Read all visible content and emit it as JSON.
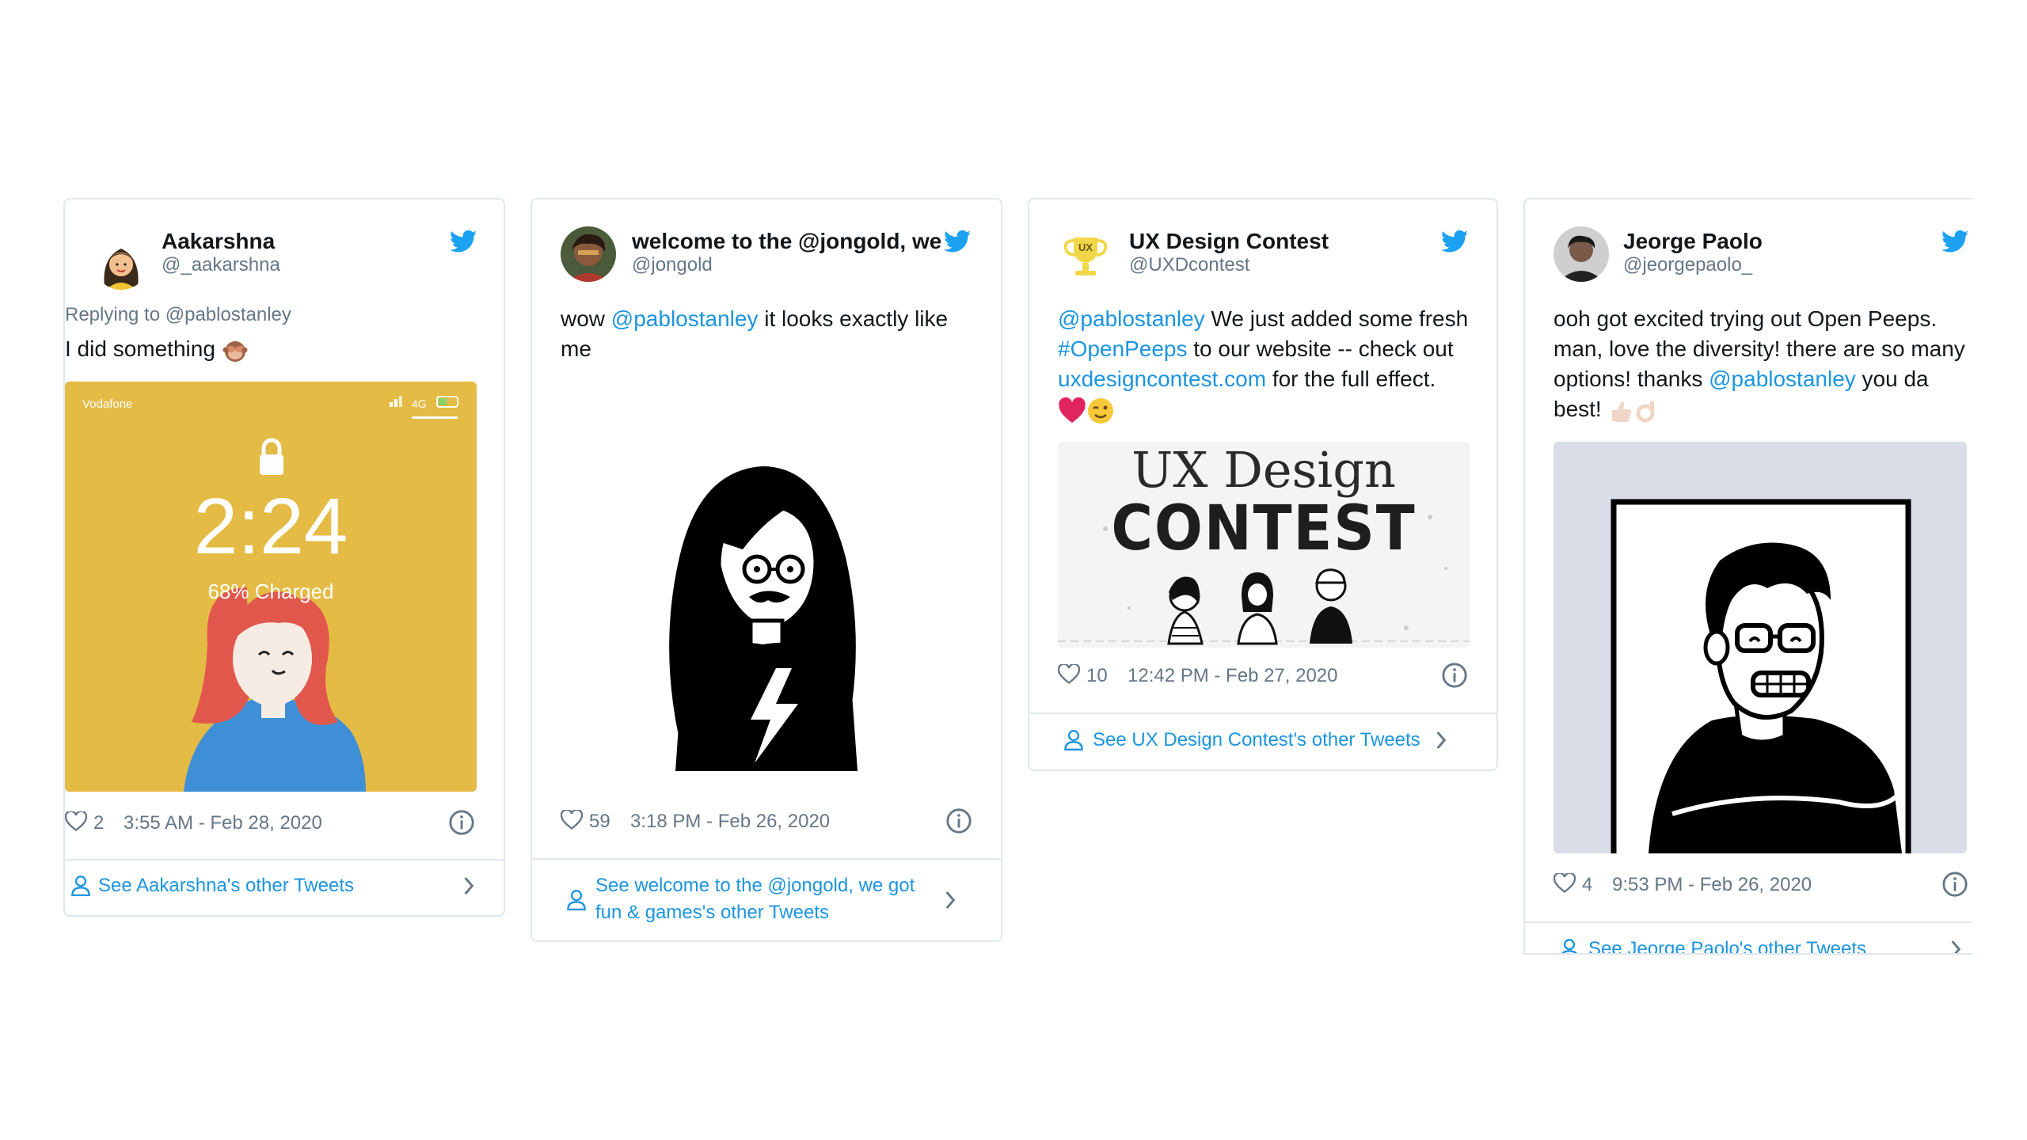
{
  "colors": {
    "link": "#1b95e0",
    "muted": "#657786",
    "border": "#e1e8ed",
    "heart_red": "#e0245e"
  },
  "tweets": [
    {
      "name": "Aakarshna",
      "handle": "@_aakarshna",
      "replying": "Replying to @pablostanley",
      "text": "I did something",
      "media": {
        "carrier": "Vodafone",
        "network": "4G",
        "time": "2:24",
        "battery_text": "68% Charged"
      },
      "likes": "2",
      "timestamp": "3:55 AM - Feb 28, 2020",
      "see_more": "See Aakarshna's other Tweets"
    },
    {
      "name": "welcome to the @jongold, we",
      "handle": "@jongold",
      "text_before": "wow ",
      "mention": "@pablostanley",
      "text_after": " it looks exactly like me",
      "likes": "59",
      "timestamp": "3:18 PM - Feb 26, 2020",
      "see_more": "See welcome to the @jongold, we got fun & games's other Tweets"
    },
    {
      "name": "UX Design Contest",
      "handle": "@UXDcontest",
      "avatar_label": "UX",
      "mention": "@pablostanley",
      "text_1": " We just added some fresh ",
      "hashtag": "#OpenPeeps",
      "text_2": " to our website -- check out ",
      "url": "uxdesigncontest.com",
      "text_3": " for the full effect.",
      "media": {
        "line1": "UX Design",
        "line2": "CONTEST"
      },
      "likes": "10",
      "timestamp": "12:42 PM - Feb 27, 2020",
      "see_more": "See UX Design Contest's other Tweets"
    },
    {
      "name": "Jeorge Paolo",
      "handle": "@jeorgepaolo_",
      "text_1": "ooh got excited trying out Open Peeps. man, love the diversity! there are so many options! thanks ",
      "mention": "@pablostanley",
      "text_2": " you da best!",
      "likes": "4",
      "timestamp": "9:53 PM - Feb 26, 2020",
      "see_more": "See Jeorge Paolo's other Tweets"
    }
  ]
}
